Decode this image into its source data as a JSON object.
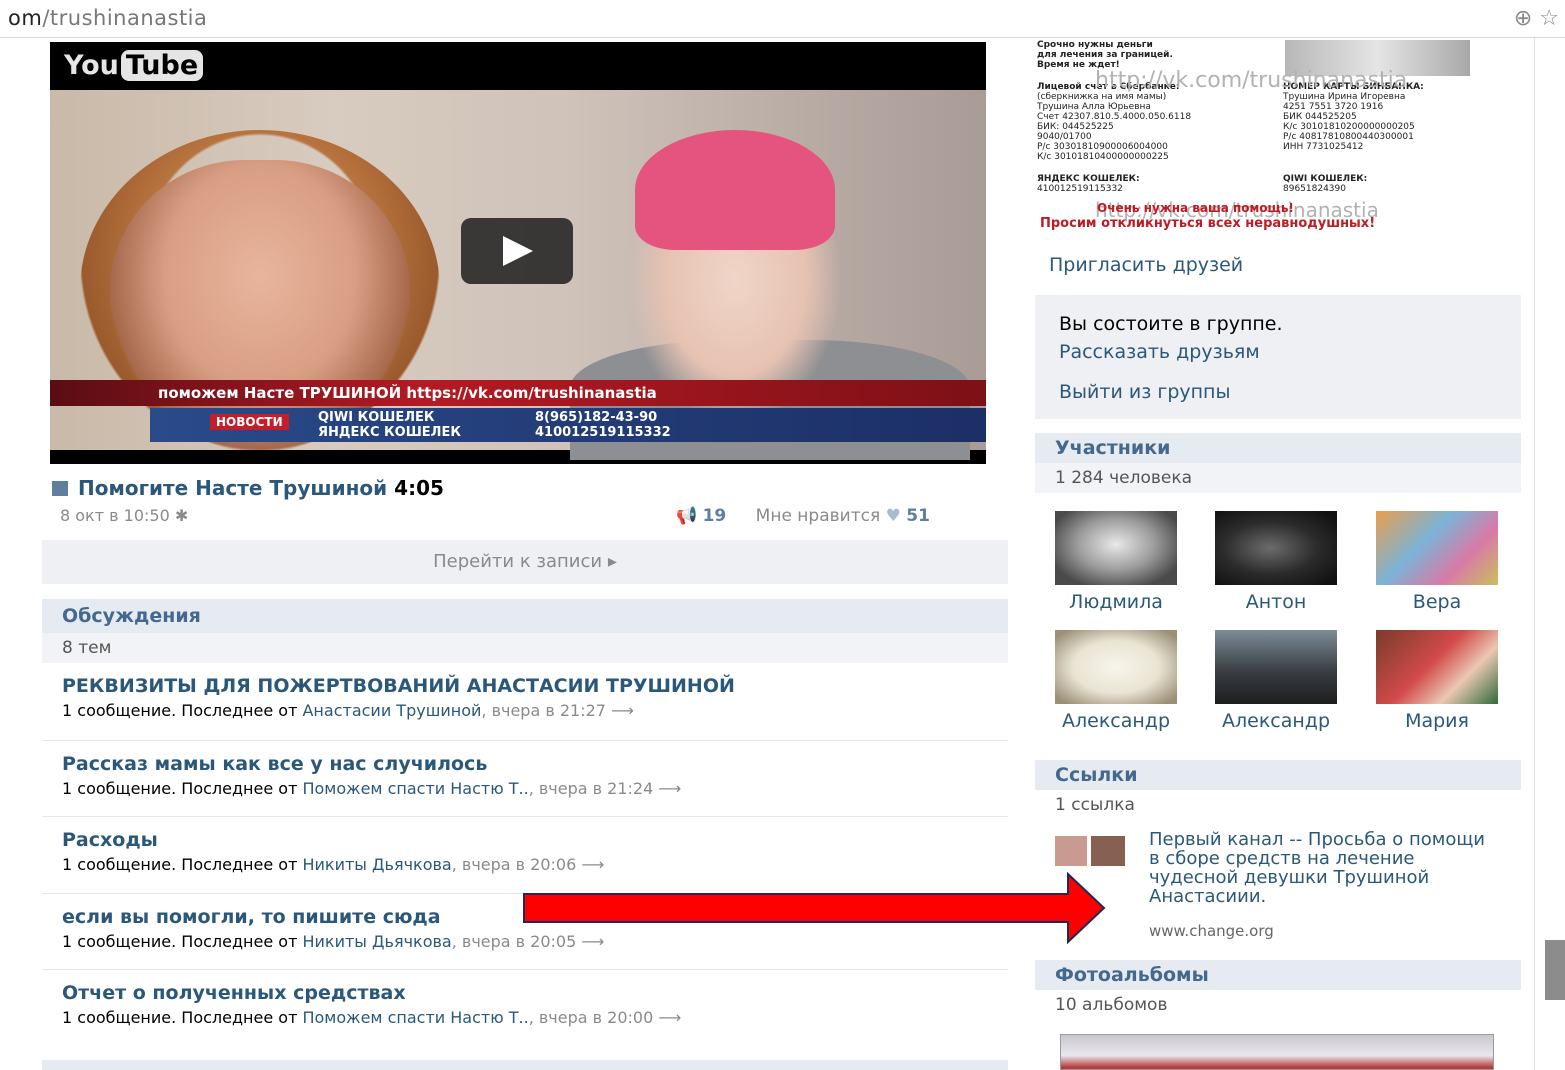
{
  "browser": {
    "url_prefix": "om",
    "url_path": "/trushinanastia",
    "zoom_icon": "zoom-icon",
    "star_icon": "bookmark-star-icon"
  },
  "video": {
    "logo_you": "You",
    "logo_tube": "Tube",
    "ticker_line": "поможем Насте ТРУШИНОЙ    https://vk.com/trushinanastia",
    "ticker_badge": "НОВОСТИ",
    "ticker_col1_a": "QIWI КОШЕЛЕК",
    "ticker_col1_b": "ЯНДЕКС КОШЕЛЕК",
    "ticker_col2_a": "8(965)182-43-90",
    "ticker_col2_b": "410012519115332"
  },
  "post": {
    "video_title": "Помогите Насте Трушиной",
    "duration": "4:05",
    "date": "8 окт в 10:50",
    "reposts": "19",
    "like_label": "Мне нравится",
    "likes": "51",
    "goto_label": "Перейти к записи ▸"
  },
  "discussions": {
    "title": "Обсуждения",
    "count": "8 тем",
    "topics": [
      {
        "title": "РЕКВИЗИТЫ ДЛЯ ПОЖЕРТВОВАНИЙ АНАСТАСИИ ТРУШИНОЙ",
        "prefix": "1 сообщение. Последнее от ",
        "author": "Анастасии Трушиной",
        "date": ", вчера в 21:27  ⟶"
      },
      {
        "title": "Рассказ мамы как все у нас случилось",
        "prefix": "1 сообщение. Последнее от ",
        "author": "Поможем спасти Настю Т..",
        "date": ", вчера в 21:24  ⟶"
      },
      {
        "title": "Расходы",
        "prefix": "1 сообщение. Последнее от ",
        "author": "Никиты Дьячкова",
        "date": ", вчера в 20:06  ⟶"
      },
      {
        "title": "если вы помогли, то пишите сюда",
        "prefix": "1 сообщение. Последнее от ",
        "author": "Никиты Дьячкова",
        "date": ", вчера в 20:05  ⟶"
      },
      {
        "title": "Отчет о полученных средствах",
        "prefix": "1 сообщение. Последнее от ",
        "author": "Поможем спасти Настю Т..",
        "date": ", вчера в 20:00  ⟶"
      }
    ]
  },
  "poster": {
    "line1": "Срочно нужны деньги",
    "line2": "для лечения за границей.",
    "line3": "Время не ждет!",
    "sber_title": "Лицевой счет в Сбербанке:",
    "sber_sub": "(сберкнижка на имя мамы)",
    "sber_name": "Трушина Алла Юрьевна",
    "sber_acc": "Счет 42307.810.5.4000.050.6118",
    "sber_bik": "БИК: 044525225",
    "sber_a": "9040/01700",
    "sber_b": "Р/с 30301810900006004000",
    "sber_c": "К/с 30101810400000000225",
    "binbank_title": "НОМЕР КАРТЫ БИНБАНКА:",
    "binbank_name": "Трушина Ирина Игоревна",
    "binbank_card": "4251 7551 3720 1916",
    "binbank_bik": "БИК 044525205",
    "binbank_ks": "К/с 30101810200000000205",
    "binbank_rs": "Р/с 40817810800440300001",
    "binbank_inn": "ИНН 7731025412",
    "yandex_title": "ЯНДЕКС КОШЕЛЕК:",
    "yandex_num": "410012519115332",
    "qiwi_title": "QIWI КОШЕЛЕК:",
    "qiwi_num": "89651824390",
    "watermark": "http://vk.com/trushinanastia",
    "urgent": "Очень нужна ваша помощь!",
    "plea": "Просим откликнуться всех неравнодушных!"
  },
  "sidebar": {
    "invite": "Пригласить друзей",
    "member_status": "Вы состоите в группе.",
    "tell_friends": "Рассказать друзьям",
    "leave": "Выйти из группы",
    "members_title": "Участники",
    "members_count": "1 284 человека",
    "members": [
      {
        "name": "Людмила"
      },
      {
        "name": "Антон"
      },
      {
        "name": "Вера"
      },
      {
        "name": "Александр"
      },
      {
        "name": "Александр"
      },
      {
        "name": "Мария"
      }
    ],
    "links_title": "Ссылки",
    "links_count": "1 ссылка",
    "link_title": "Первый канал -- Просьба о помощи в сборе средств на лечение чудесной девушки Трушиной Анастасиии.",
    "link_domain": "www.change.org",
    "albums_title": "Фотоальбомы",
    "albums_count": "10 альбомов"
  },
  "colors": {
    "link": "#2b587a",
    "section_header_bg": "#e5ebf1",
    "arrow_red": "#ff0000"
  }
}
